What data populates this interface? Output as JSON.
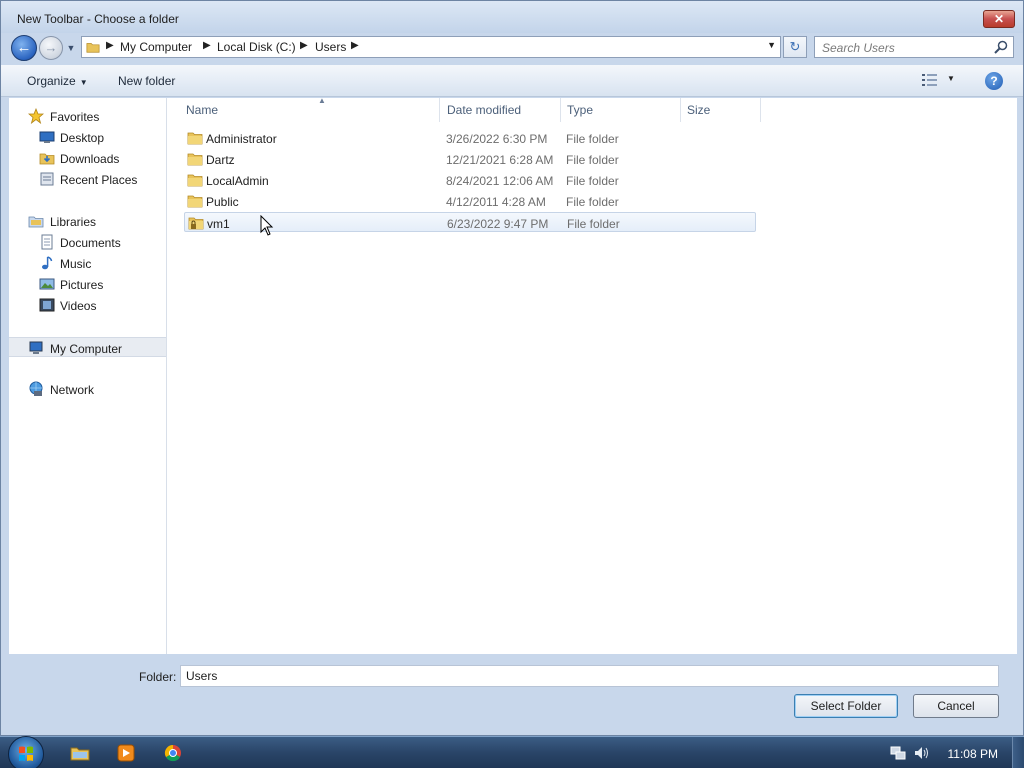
{
  "window": {
    "title": "New Toolbar - Choose a folder",
    "close_label": "✕"
  },
  "address": {
    "crumbs": [
      "My Computer",
      "Local Disk (C:)",
      "Users"
    ],
    "search_placeholder": "Search Users"
  },
  "toolbar": {
    "organize_label": "Organize",
    "new_folder_label": "New folder",
    "help_label": "?"
  },
  "nav": {
    "favorites": {
      "label": "Favorites",
      "items": [
        {
          "label": "Desktop",
          "icon": "desktop-icon"
        },
        {
          "label": "Downloads",
          "icon": "downloads-icon"
        },
        {
          "label": "Recent Places",
          "icon": "recent-places-icon"
        }
      ]
    },
    "libraries": {
      "label": "Libraries",
      "items": [
        {
          "label": "Documents",
          "icon": "documents-icon"
        },
        {
          "label": "Music",
          "icon": "music-icon"
        },
        {
          "label": "Pictures",
          "icon": "pictures-icon"
        },
        {
          "label": "Videos",
          "icon": "videos-icon"
        }
      ]
    },
    "computer": {
      "label": "My Computer"
    },
    "network": {
      "label": "Network"
    }
  },
  "columns": {
    "name": "Name",
    "date": "Date modified",
    "type": "Type",
    "size": "Size"
  },
  "files": [
    {
      "name": "Administrator",
      "date": "3/26/2022 6:30 PM",
      "type": "File folder",
      "locked": false
    },
    {
      "name": "Dartz",
      "date": "12/21/2021 6:28 AM",
      "type": "File folder",
      "locked": false
    },
    {
      "name": "LocalAdmin",
      "date": "8/24/2021 12:06 AM",
      "type": "File folder",
      "locked": false
    },
    {
      "name": "Public",
      "date": "4/12/2011 4:28 AM",
      "type": "File folder",
      "locked": false
    },
    {
      "name": "vm1",
      "date": "6/23/2022 9:47 PM",
      "type": "File folder",
      "locked": true,
      "selected": true
    }
  ],
  "footer": {
    "folder_label": "Folder:",
    "folder_value": "Users",
    "select_label": "Select Folder",
    "cancel_label": "Cancel"
  },
  "taskbar": {
    "clock": "11:08 PM"
  }
}
